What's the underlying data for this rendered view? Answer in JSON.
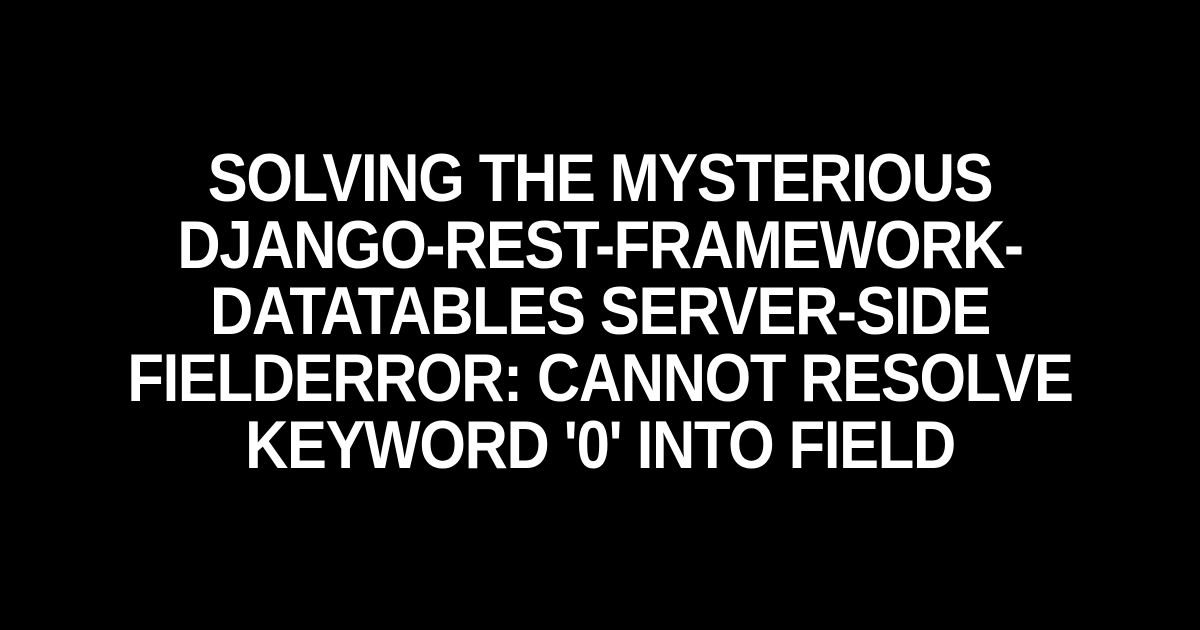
{
  "title": "SOLVING THE MYSTERIOUS DJANGO-REST-FRAMEWORK-DATATABLES SERVER-SIDE FIELDERROR: CANNOT RESOLVE KEYWORD '0' INTO FIELD"
}
